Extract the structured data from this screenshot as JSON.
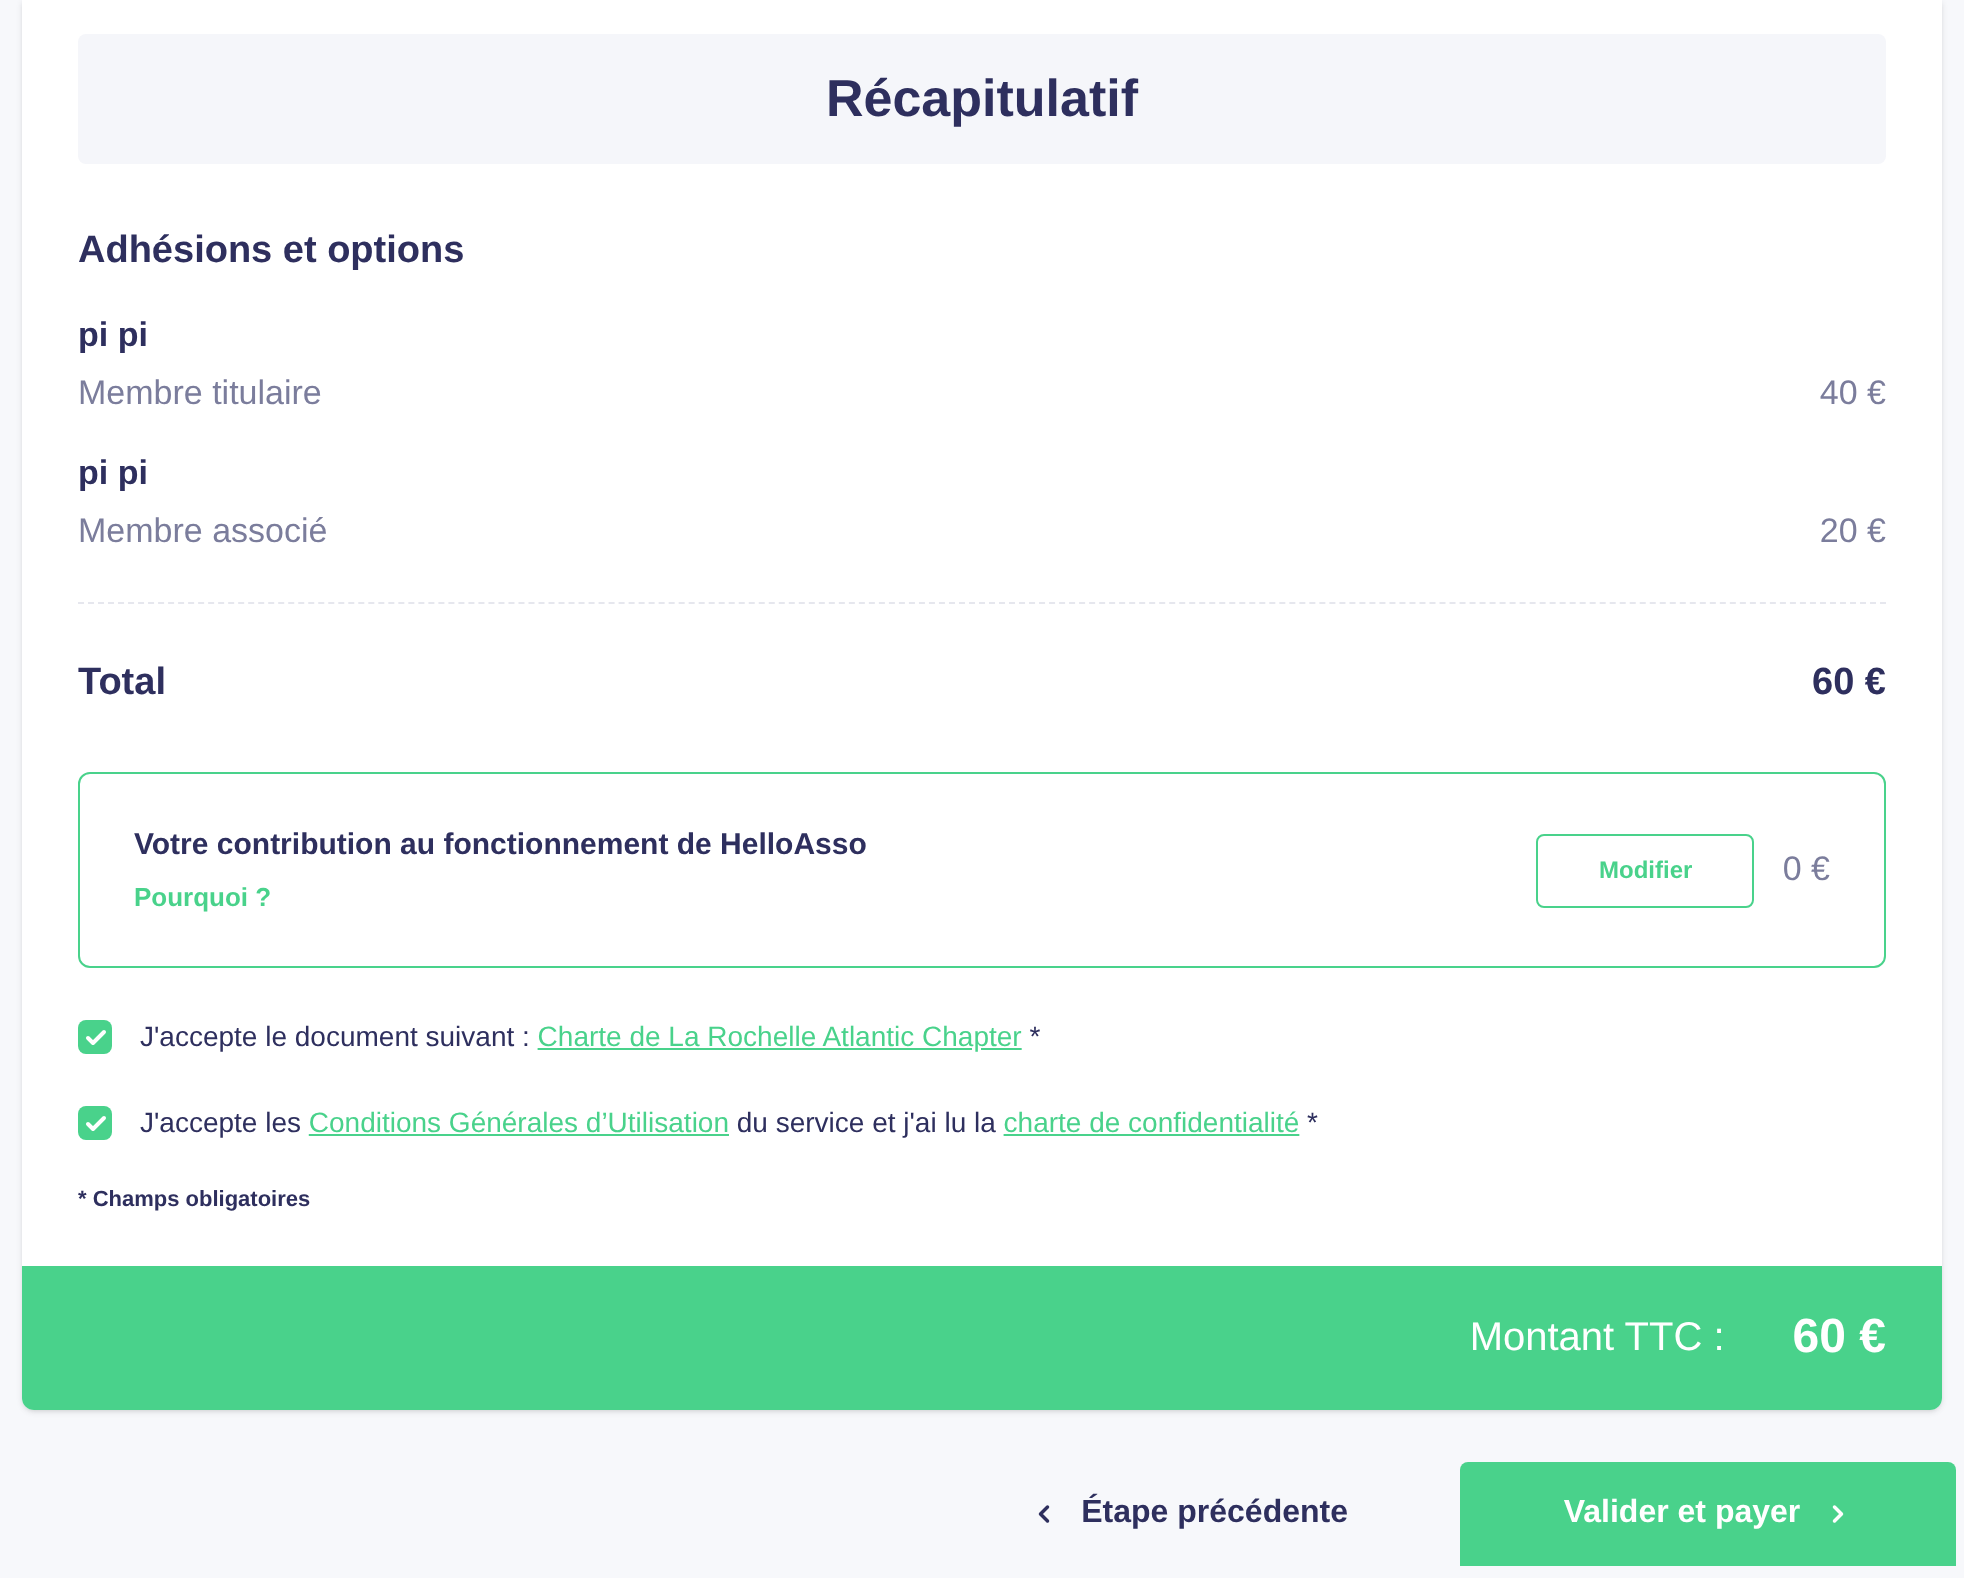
{
  "title": "Récapitulatif",
  "section_heading": "Adhésions et options",
  "items": [
    {
      "name": "pi pi",
      "type": "Membre titulaire",
      "price": "40 €"
    },
    {
      "name": "pi pi",
      "type": "Membre associé",
      "price": "20 €"
    }
  ],
  "total": {
    "label": "Total",
    "amount": "60 €"
  },
  "contribution": {
    "title": "Votre contribution au fonctionnement de HelloAsso",
    "link": "Pourquoi ?",
    "button": "Modifier",
    "amount": "0 €"
  },
  "agreements": [
    {
      "checked": true,
      "parts": [
        {
          "kind": "text",
          "text": "J'accepte le document suivant : "
        },
        {
          "kind": "link",
          "text": "Charte de La Rochelle Atlantic Chapter"
        },
        {
          "kind": "text",
          "text": " *"
        }
      ]
    },
    {
      "checked": true,
      "parts": [
        {
          "kind": "text",
          "text": "J'accepte les "
        },
        {
          "kind": "link",
          "text": "Conditions Générales d’Utilisation"
        },
        {
          "kind": "text",
          "text": " du service et j'ai lu la "
        },
        {
          "kind": "link",
          "text": "charte de confidentialité"
        },
        {
          "kind": "text",
          "text": " *"
        }
      ]
    }
  ],
  "required_note": "* Champs obligatoires",
  "amount_bar": {
    "label": "Montant TTC :",
    "amount": "60 €"
  },
  "back_button": "Étape précédente",
  "pay_button": "Valider et payer"
}
